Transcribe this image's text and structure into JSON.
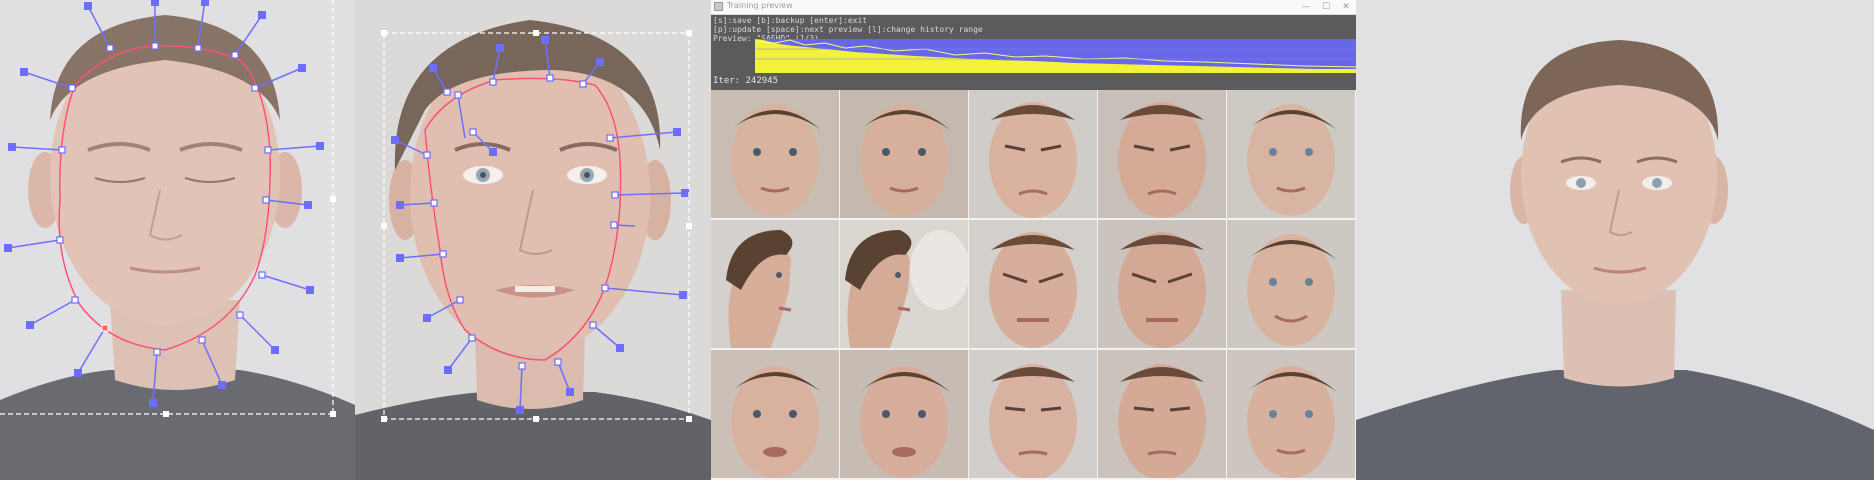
{
  "window": {
    "title": "Training preview",
    "minimize_glyph": "—",
    "maximize_glyph": "☐",
    "close_glyph": "✕"
  },
  "console": {
    "line1": "[s]:save [b]:backup [enter]:exit",
    "line2": "[p]:update [space]:next preview [l]:change history range",
    "line3": "Preview: \"SAEHD\" (1/3)",
    "iter_label": "Iter: 242945"
  },
  "loss_graph": {
    "background_color": "#6767e8",
    "series_colors": [
      "#f2f23a",
      "#6767e8"
    ]
  },
  "preview_grid": {
    "rows": 3,
    "columns": 5
  },
  "landmark_colors": {
    "outline": "#ff2a5a",
    "handle": "#4d4dff",
    "selected_point": "#ff4040",
    "bounding_box": "#ffffff"
  }
}
